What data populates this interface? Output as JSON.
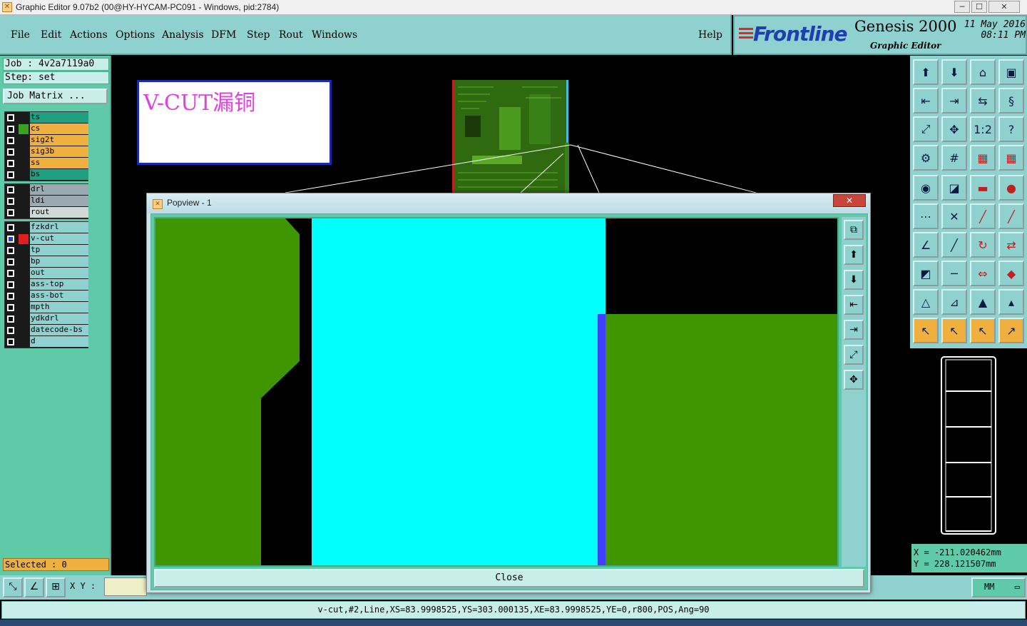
{
  "window": {
    "title": "Graphic Editor 9.07b2 (00@HY-HYCAM-PC091 - Windows, pid:2784)",
    "min_label": "─",
    "max_label": "☐",
    "close_label": "✕"
  },
  "menu": {
    "items": [
      "File",
      "Edit",
      "Actions",
      "Options",
      "Analysis",
      "DFM",
      "Step",
      "Rout",
      "Windows"
    ],
    "help": "Help"
  },
  "brand": {
    "logo": "Frontline",
    "product": "Genesis 2000",
    "subtitle": "Graphic Editor",
    "date": "11 May 2016",
    "time": "08:11 PM"
  },
  "job": {
    "job_label": "Job  : 4v2a7119a0",
    "step_label": "Step: set",
    "matrix_button": "Job Matrix ..."
  },
  "layers": {
    "group1": [
      {
        "name": "ts",
        "color": "#1fa080",
        "swatch": ""
      },
      {
        "name": "cs",
        "color": "#f0b040",
        "swatch": "#3aa020"
      },
      {
        "name": "sig2t",
        "color": "#f0b040",
        "swatch": ""
      },
      {
        "name": "sig3b",
        "color": "#f0b040",
        "swatch": ""
      },
      {
        "name": "ss",
        "color": "#f0b040",
        "swatch": ""
      },
      {
        "name": "bs",
        "color": "#1fa080",
        "swatch": ""
      }
    ],
    "group2": [
      {
        "name": "drl",
        "color": "#9aaab0",
        "swatch": ""
      },
      {
        "name": "ldi",
        "color": "#9aaab0",
        "swatch": ""
      },
      {
        "name": "rout",
        "color": "#d0d8d8",
        "swatch": ""
      }
    ],
    "group3": [
      {
        "name": "fzkdrl",
        "color": "#8fd1cf",
        "swatch": ""
      },
      {
        "name": "v-cut",
        "color": "#8fd1cf",
        "swatch": "#e02020",
        "active": true
      },
      {
        "name": "tp",
        "color": "#8fd1cf",
        "swatch": ""
      },
      {
        "name": "bp",
        "color": "#8fd1cf",
        "swatch": ""
      },
      {
        "name": "out",
        "color": "#8fd1cf",
        "swatch": ""
      },
      {
        "name": "ass-top",
        "color": "#8fd1cf",
        "swatch": ""
      },
      {
        "name": "ass-bot",
        "color": "#8fd1cf",
        "swatch": ""
      },
      {
        "name": "mpth",
        "color": "#8fd1cf",
        "swatch": ""
      },
      {
        "name": "ydkdrl",
        "color": "#8fd1cf",
        "swatch": ""
      },
      {
        "name": "datecode-bs",
        "color": "#8fd1cf",
        "swatch": ""
      },
      {
        "name": "d",
        "color": "#8fd1cf",
        "swatch": ""
      }
    ]
  },
  "selected_label": "Selected : 0",
  "note_text": "V-CUT漏铜",
  "popview": {
    "title": "Popview - 1",
    "close_x": "✕",
    "close_button": "Close"
  },
  "coords": {
    "x": "X  =  -211.020462mm",
    "y": "Y  =  228.121507mm"
  },
  "bottom": {
    "xy_label": "X Y :",
    "units": "MM"
  },
  "status": "v-cut,#2,Line,XS=83.9998525,YS=303.000135,XE=83.9998525,YE=0,r800,POS,Ang=90",
  "colors": {
    "copper": "#409600",
    "vcut_fill": "#00ffff",
    "vcut_edge": "#4040ff",
    "panel": "#8fd1cf"
  }
}
